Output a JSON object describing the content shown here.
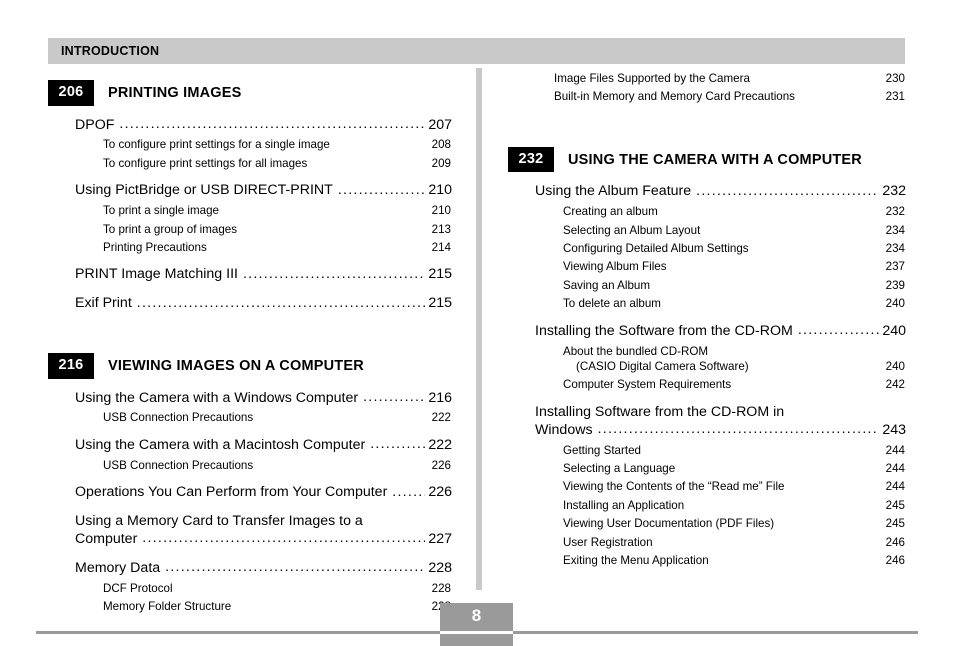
{
  "header": {
    "label": "INTRODUCTION"
  },
  "footer": {
    "page_number": "8"
  },
  "colors": {
    "header_bar": "#c9c9c9",
    "badge_bg": "#000000",
    "badge_text": "#ffffff",
    "divider": "#c9c9c9",
    "footer_rule": "#9a9a9a",
    "page_box": "#9a9a9a"
  },
  "columns": {
    "left": {
      "sections": [
        {
          "badge": "206",
          "title": "PRINTING IMAGES",
          "entries": [
            {
              "level": 1,
              "title": "DPOF",
              "page": "207"
            },
            {
              "level": 2,
              "title": "To configure print settings for a single image",
              "page": "208"
            },
            {
              "level": 2,
              "title": "To configure print settings for all images",
              "page": "209"
            },
            {
              "level": 1,
              "title": "Using PictBridge or USB DIRECT-PRINT",
              "page": "210"
            },
            {
              "level": 2,
              "title": "To print a single image",
              "page": "210"
            },
            {
              "level": 2,
              "title": "To print a group of images",
              "page": "213"
            },
            {
              "level": 2,
              "title": "Printing Precautions",
              "page": "214"
            },
            {
              "level": 1,
              "title": "PRINT Image Matching III",
              "page": "215"
            },
            {
              "level": 1,
              "title": "Exif Print",
              "page": "215"
            }
          ]
        },
        {
          "badge": "216",
          "title": "VIEWING IMAGES ON A COMPUTER",
          "entries": [
            {
              "level": 1,
              "title": "Using the Camera with a Windows Computer",
              "page": "216"
            },
            {
              "level": 2,
              "title": "USB Connection Precautions",
              "page": "222"
            },
            {
              "level": 1,
              "title": "Using the Camera with a Macintosh Computer",
              "page": "222"
            },
            {
              "level": 2,
              "title": "USB Connection Precautions",
              "page": "226"
            },
            {
              "level": 1,
              "title": "Operations You Can Perform from Your Computer",
              "page": "226"
            },
            {
              "level": 1,
              "wrapped": true,
              "line1": "Using a Memory Card to Transfer Images to a",
              "line2": "Computer",
              "title": "Using a Memory Card to Transfer Images to a Computer",
              "page": "227"
            },
            {
              "level": 1,
              "title": "Memory Data",
              "page": "228"
            },
            {
              "level": 2,
              "title": "DCF Protocol",
              "page": "228"
            },
            {
              "level": 2,
              "title": "Memory Folder Structure",
              "page": "228"
            }
          ]
        }
      ]
    },
    "right": {
      "orphan_entries": [
        {
          "level": 2,
          "title": "Image Files Supported by the Camera",
          "page": "230"
        },
        {
          "level": 2,
          "title": "Built-in Memory and Memory Card Precautions",
          "page": "231"
        }
      ],
      "sections": [
        {
          "badge": "232",
          "title": "USING THE CAMERA WITH A COMPUTER",
          "entries": [
            {
              "level": 1,
              "title": "Using the Album Feature",
              "page": "232"
            },
            {
              "level": 2,
              "title": "Creating an album",
              "page": "232"
            },
            {
              "level": 2,
              "title": "Selecting an Album Layout",
              "page": "234"
            },
            {
              "level": 2,
              "title": "Configuring Detailed Album Settings",
              "page": "234"
            },
            {
              "level": 2,
              "title": "Viewing Album Files",
              "page": "237"
            },
            {
              "level": 2,
              "title": "Saving an Album",
              "page": "239"
            },
            {
              "level": 2,
              "title": "To delete an album",
              "page": "240"
            },
            {
              "level": 1,
              "title": "Installing the Software from the CD-ROM",
              "page": "240"
            },
            {
              "level": 2,
              "two_line": true,
              "line1": "About the bundled CD-ROM",
              "line2": "(CASIO Digital Camera Software)",
              "title": "About the bundled CD-ROM (CASIO Digital Camera Software)",
              "page": "240"
            },
            {
              "level": 2,
              "title": "Computer System Requirements",
              "page": "242"
            },
            {
              "level": 1,
              "wrapped": true,
              "line1": "Installing Software from the CD-ROM in",
              "line2": "Windows",
              "title": "Installing Software from the CD-ROM in Windows",
              "page": "243"
            },
            {
              "level": 2,
              "title": "Getting Started",
              "page": "244"
            },
            {
              "level": 2,
              "title": "Selecting a Language",
              "page": "244"
            },
            {
              "level": 2,
              "title": "Viewing the Contents of the “Read me” File",
              "page": "244"
            },
            {
              "level": 2,
              "title": "Installing an Application",
              "page": "245"
            },
            {
              "level": 2,
              "title": "Viewing User Documentation (PDF Files)",
              "page": "245"
            },
            {
              "level": 2,
              "title": "User Registration",
              "page": "246"
            },
            {
              "level": 2,
              "title": "Exiting the Menu Application",
              "page": "246"
            }
          ]
        }
      ]
    }
  }
}
